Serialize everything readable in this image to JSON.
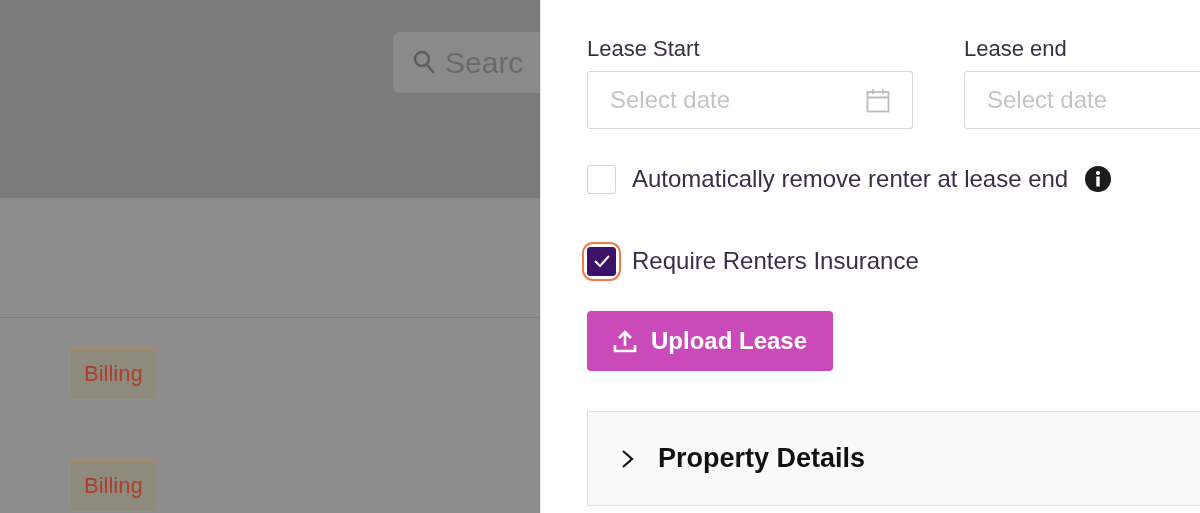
{
  "search": {
    "placeholder": "Searc"
  },
  "tags": [
    {
      "label": "Billing"
    },
    {
      "label": "Billing"
    }
  ],
  "date_fields": [
    {
      "label": "Lease Start",
      "placeholder": "Select date",
      "icon": true
    },
    {
      "label": "Lease end",
      "placeholder": "Select date",
      "icon": false
    }
  ],
  "checkboxes": [
    {
      "label": "Automatically remove renter at lease end",
      "checked": false,
      "focused": false,
      "info": true
    },
    {
      "label": "Require Renters Insurance",
      "checked": true,
      "focused": true,
      "info": false
    }
  ],
  "upload_button": {
    "label": "Upload Lease"
  },
  "accordion": {
    "title": "Property Details",
    "expanded": false
  }
}
